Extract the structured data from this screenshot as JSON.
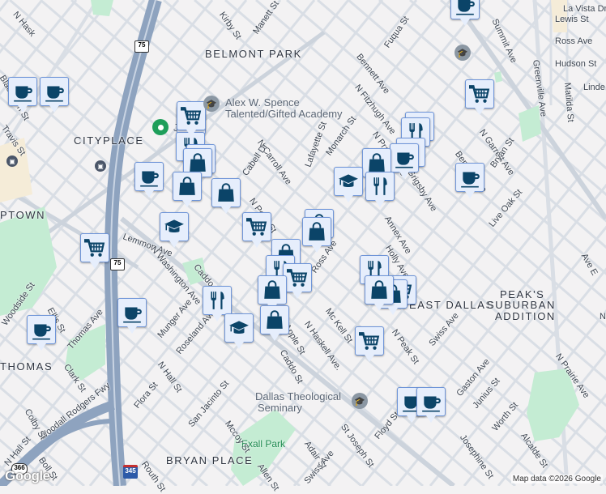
{
  "map": {
    "neighborhoods": [
      "BELMONT PARK",
      "CITYPLACE",
      "PTOWN",
      "THOMAS",
      "BRYAN PLACE",
      "EAST DALLAS",
      "PEAK'S",
      "SUBURBAN",
      "ADDITION"
    ],
    "pois": [
      "Alex W. Spence",
      "Talented/Gifted Academy",
      "Dallas Theological",
      "Seminary",
      "Jess"
    ],
    "parks": [
      "Exall Park"
    ],
    "streets": [
      "Kirby St",
      "Manett St",
      "Fuqua St",
      "Bennett Ave",
      "N Fitzhugh Ave",
      "Monarch St",
      "Lafayette St",
      "N Carroll Ave",
      "Cabell Dr",
      "N Peak St",
      "Ross Ave",
      "N Prairie Ave",
      "Grigsby Ave",
      "Annex Ave",
      "Holly Ave",
      "N Garrett Ave",
      "Bennett Ave",
      "Bryan St",
      "Live Oak St",
      "Summit Ave",
      "Greenville Ave",
      "Matilda St",
      "La Vista Dr",
      "Lewis St",
      "Ross Ave",
      "Hudson St",
      "Linde",
      "Lemmon Ave",
      "N Washington Ave",
      "Caddo St",
      "N Hall St",
      "Munger Ave",
      "Roseland Ave",
      "Apple St",
      "Caddo St",
      "N Haskell Ave.",
      "Mc Kell St",
      "N Peak St",
      "Swiss Ave",
      "Gaston Ave",
      "Junius St",
      "Worth St",
      "Alcalde St",
      "Josephine St",
      "N Prairie Ave",
      "St Joseph St",
      "Floyd St",
      "Adair St",
      "Swiss Ave",
      "San Jacinto St",
      "Mccoy St",
      "Flora St",
      "Woodall Rodgers Fwy",
      "Clark St",
      "Thomas Ave",
      "Ellis St",
      "Woodside St",
      "N Hall St",
      "Colby St",
      "Boll St",
      "Routh St",
      "Allen St",
      "N Hask",
      "Blackburn St",
      "Travis St",
      "Ave E",
      "N Col",
      "M",
      "N Carroll Ave"
    ],
    "shields": [
      "75",
      "75",
      "345",
      "366"
    ],
    "attribution": "Map data ©2026 Google",
    "logo": "Google"
  },
  "markers": [
    "coffee",
    "coffee",
    "coffee",
    "cart",
    "cart",
    "cart",
    "restaurant",
    "shopping",
    "shopping",
    "coffee",
    "shopping",
    "shopping",
    "school",
    "cart",
    "cart",
    "shopping",
    "shopping",
    "shopping",
    "restaurant",
    "cart",
    "shopping",
    "restaurant",
    "school",
    "shopping",
    "coffee",
    "coffee",
    "restaurant",
    "restaurant",
    "restaurant",
    "coffee",
    "shopping",
    "school",
    "restaurant",
    "coffee",
    "restaurant",
    "cart",
    "shopping",
    "shopping",
    "cart",
    "coffee",
    "coffee"
  ],
  "colors": {
    "marker_fill": "#e6eefc",
    "marker_border": "#6f95d8",
    "icon": "#0b4468",
    "highway": "#8ea3bf",
    "park": "#c4ecd3",
    "road": "#d9dee5"
  }
}
